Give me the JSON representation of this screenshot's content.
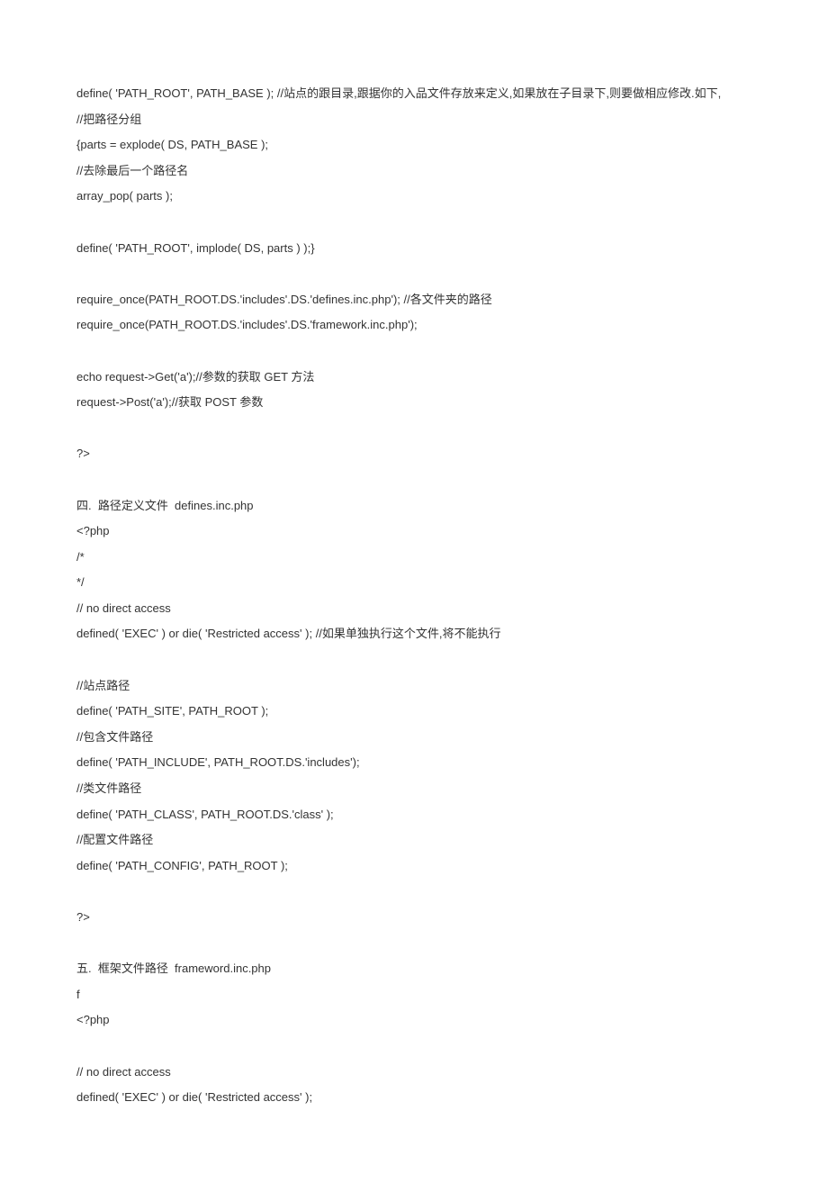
{
  "lines": [
    "define( 'PATH_ROOT', PATH_BASE ); //站点的跟目录,跟据你的入品文件存放来定义,如果放在子目录下,则要做相应修改.如下,",
    "//把路径分组",
    "{parts = explode( DS, PATH_BASE );",
    "//去除最后一个路径名",
    "array_pop( parts );",
    "",
    "define( 'PATH_ROOT', implode( DS, parts ) );}",
    "",
    "require_once(PATH_ROOT.DS.'includes'.DS.'defines.inc.php'); //各文件夹的路径",
    "require_once(PATH_ROOT.DS.'includes'.DS.'framework.inc.php');",
    "",
    "echo request->Get('a');//参数的获取 GET 方法",
    "request->Post('a');//获取 POST 参数",
    "",
    "?>",
    "",
    "四.  路径定义文件  defines.inc.php",
    "<?php",
    "/*",
    "*/",
    "// no direct access",
    "defined( 'EXEC' ) or die( 'Restricted access' ); //如果单独执行这个文件,将不能执行",
    "",
    "//站点路径",
    "define( 'PATH_SITE', PATH_ROOT );",
    "//包含文件路径",
    "define( 'PATH_INCLUDE', PATH_ROOT.DS.'includes');",
    "//类文件路径",
    "define( 'PATH_CLASS', PATH_ROOT.DS.'class' );",
    "//配置文件路径",
    "define( 'PATH_CONFIG', PATH_ROOT );",
    "",
    "?>",
    "",
    "五.  框架文件路径  frameword.inc.php",
    "f",
    "<?php",
    "",
    "// no direct access",
    "defined( 'EXEC' ) or die( 'Restricted access' );"
  ]
}
